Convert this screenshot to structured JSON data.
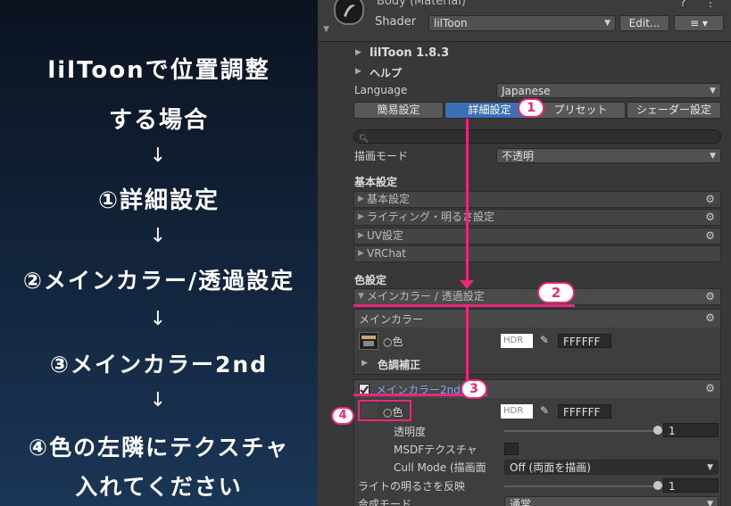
{
  "instructions": {
    "line1": "lilToonで位置調整",
    "line2": "する場合",
    "arrow": "↓",
    "step1": "①詳細設定",
    "step2": "②メインカラー/透過設定",
    "step3": "③メインカラー2nd",
    "step4a": "④色の左隣にテクスチャ",
    "step4b": "入れてください"
  },
  "header": {
    "material_title": "Body (Material)",
    "shader_label": "Shader",
    "shader_value": "lilToon",
    "edit_button": "Edit...",
    "menu_icon": "list-icon",
    "help_icon": "?",
    "more_icon": "⋮"
  },
  "inspector": {
    "version": "lilToon 1.8.3",
    "help": "ヘルプ",
    "language_label": "Language",
    "language_value": "Japanese",
    "tabs": [
      "簡易設定",
      "詳細設定",
      "プリセット",
      "シェーダー設定"
    ],
    "search_placeholder": "",
    "render_mode_label": "描画モード",
    "render_mode_value": "不透明",
    "basic_heading": "基本設定",
    "basic_sections": [
      "基本設定",
      "ライティング・明るさ設定",
      "UV設定",
      "VRChat"
    ],
    "color_heading": "色設定",
    "main_color_section": "メインカラー / 透過設定",
    "main_color": {
      "title": "メインカラー",
      "color_label": "○色",
      "hdr": "HDR",
      "hex": "FFFFFF",
      "tone": "色調補正"
    },
    "main_color_2nd": {
      "title": "メインカラー2nd",
      "color_label": "○色",
      "hdr": "HDR",
      "hex": "FFFFFF",
      "opacity_label": "透明度",
      "opacity_value": "1",
      "opacity_level": 1.0,
      "msdf_label": "MSDFテクスチャ",
      "cull_label": "Cull Mode (描画面",
      "cull_value": "Off (両面を描画)",
      "light_label": "ライトの明るさを反映",
      "light_value": "1",
      "light_level": 1.0,
      "blend_label": "合成モード",
      "blend_value": "通常"
    }
  },
  "annotations": {
    "n1": "1",
    "n2": "2",
    "n3": "3",
    "n4": "4"
  },
  "colors": {
    "annotation": "#e8287a",
    "active_tab": "#3d6fb4"
  }
}
